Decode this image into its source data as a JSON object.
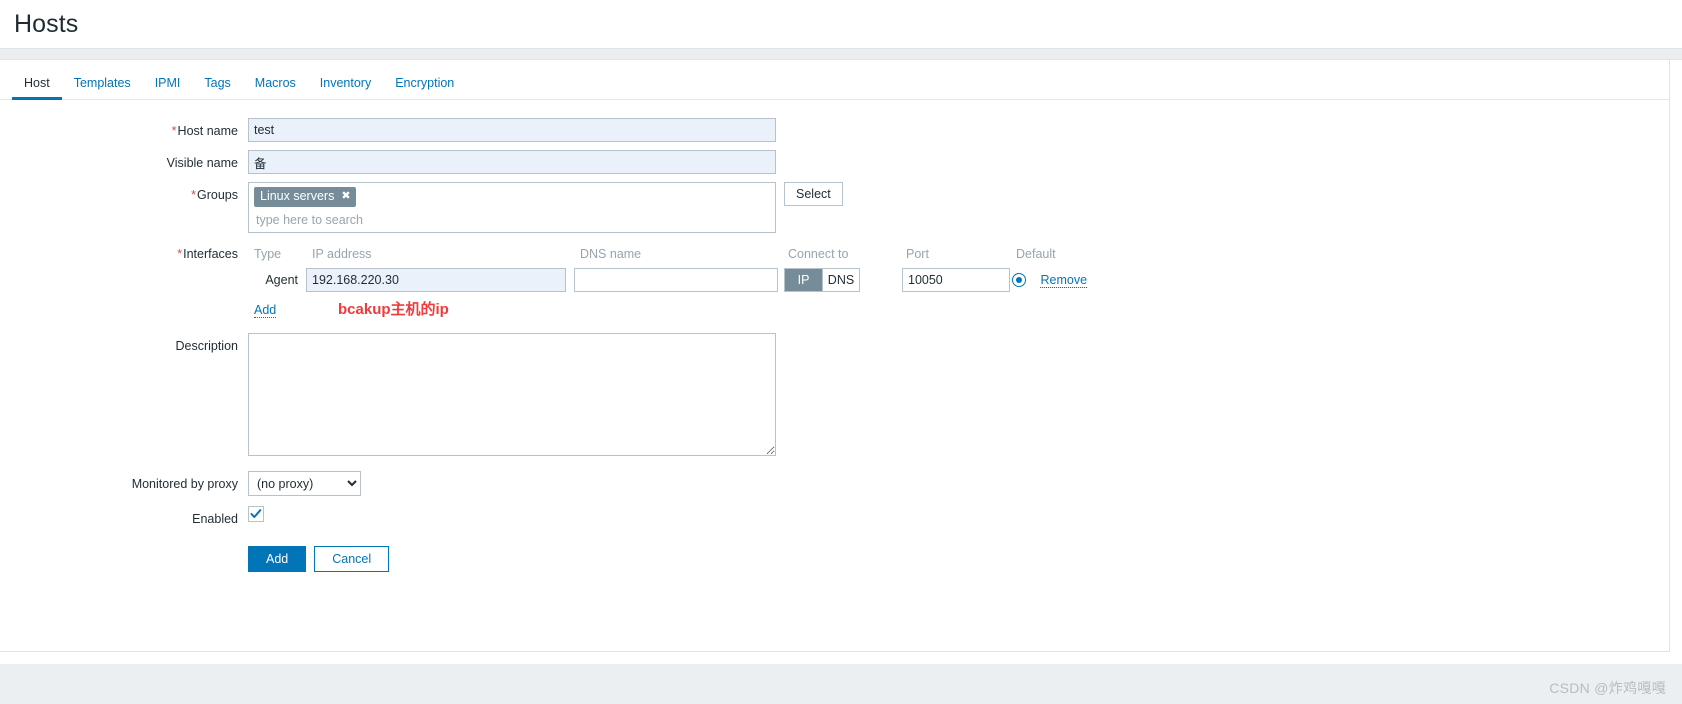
{
  "header": {
    "title": "Hosts"
  },
  "tabs": [
    {
      "label": "Host",
      "active": true
    },
    {
      "label": "Templates",
      "active": false
    },
    {
      "label": "IPMI",
      "active": false
    },
    {
      "label": "Tags",
      "active": false
    },
    {
      "label": "Macros",
      "active": false
    },
    {
      "label": "Inventory",
      "active": false
    },
    {
      "label": "Encryption",
      "active": false
    }
  ],
  "form": {
    "host_name": {
      "label": "Host name",
      "required": "*",
      "value": "test"
    },
    "visible_name": {
      "label": "Visible name",
      "required": "",
      "value": "备"
    },
    "groups": {
      "label": "Groups",
      "required": "*",
      "chips": [
        {
          "label": "Linux servers",
          "remove_glyph": "✖"
        }
      ],
      "placeholder": "type here to search",
      "select_button": "Select"
    },
    "interfaces": {
      "label": "Interfaces",
      "required": "*",
      "columns": {
        "type": "Type",
        "ip_address": "IP address",
        "dns_name": "DNS name",
        "connect_to": "Connect to",
        "port": "Port",
        "default": "Default"
      },
      "rows": [
        {
          "type": "Agent",
          "ip": "192.168.220.30",
          "dns": "",
          "connect_ip_label": "IP",
          "connect_dns_label": "DNS",
          "connect_selected": "IP",
          "port": "10050",
          "default_selected": true,
          "remove_label": "Remove"
        }
      ],
      "add_link": "Add",
      "annotation": "bcakup主机的ip",
      "annotation_color": "#ef3b3b"
    },
    "description": {
      "label": "Description",
      "value": "",
      "placeholder": ""
    },
    "monitored_by_proxy": {
      "label": "Monitored by proxy",
      "selected": "(no proxy)",
      "options": [
        "(no proxy)"
      ]
    },
    "enabled": {
      "label": "Enabled",
      "checked": true
    }
  },
  "footer": {
    "submit_label": "Add",
    "cancel_label": "Cancel"
  },
  "watermark": {
    "text": "CSDN @炸鸡嘎嘎"
  },
  "colors": {
    "accent": "#0275b8",
    "chip_bg": "#768d99",
    "required_red": "#d45050",
    "annotation_red": "#ef3b3b",
    "field_focus_bg": "#eaf1fb"
  }
}
